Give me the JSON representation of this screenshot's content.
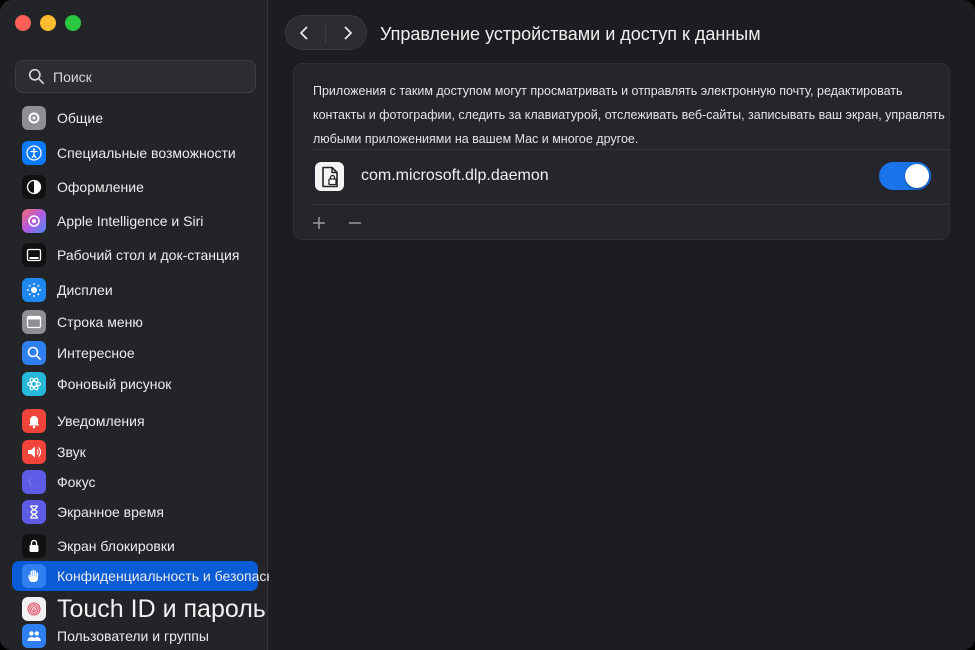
{
  "window": {
    "title": "Управление устройствами и доступ к данным"
  },
  "sidebar": {
    "search": {
      "placeholder": "Поиск",
      "icon": "search-icon"
    },
    "items": [
      {
        "label": "Общие",
        "icon": "gear-icon",
        "color": "#8e8e93"
      },
      {
        "label": "Специальные возможности",
        "icon": "accessibility-icon",
        "color": "#0a7aff"
      },
      {
        "label": "Оформление",
        "icon": "appearance-icon",
        "color": "#111111"
      },
      {
        "label": "Apple Intelligence и Siri",
        "icon": "siri-icon",
        "color": "#c25bd6"
      },
      {
        "label": "Рабочий стол и док-станция",
        "icon": "dock-icon",
        "color": "#111111"
      },
      {
        "label": "Дисплеи",
        "icon": "sun-icon",
        "color": "#1e88f0"
      },
      {
        "label": "Строка меню",
        "icon": "menubar-icon",
        "color": "#8e8e93"
      },
      {
        "label": "Интересное",
        "icon": "spotlight-icon",
        "color": "#2f7ff0"
      },
      {
        "label": "Фоновый рисунок",
        "icon": "wallpaper-icon",
        "color": "#25b8d8"
      },
      {
        "label": "Уведомления",
        "icon": "bell-icon",
        "color": "#f0443a"
      },
      {
        "label": "Звук",
        "icon": "speaker-icon",
        "color": "#f0443a"
      },
      {
        "label": "Фокус",
        "icon": "moon-icon",
        "color": "#5e5ce6"
      },
      {
        "label": "Экранное время",
        "icon": "hourglass-icon",
        "color": "#5e5ce6"
      },
      {
        "label": "Экран блокировки",
        "icon": "lock-icon",
        "color": "#111111"
      },
      {
        "label": "Конфиденциальность и безопасность",
        "icon": "hand-icon",
        "color": "#2f7ff0",
        "active": true
      },
      {
        "label": "Touch ID и пароль",
        "icon": "fingerprint-icon",
        "color": "#f2f2f2"
      },
      {
        "label": "Пользователи и группы",
        "icon": "users-icon",
        "color": "#2f7ff0"
      }
    ]
  },
  "main": {
    "back_icon": "chevron-left-icon",
    "forward_icon": "chevron-right-icon",
    "description": "Приложения с таким доступом могут просматривать и отправлять электронную почту, редактировать контакты и фотографии, следить за клавиатурой, отслеживать веб-сайты, записывать ваш экран, управлять любыми приложениями на вашем Mac и многое другое.",
    "apps": [
      {
        "name": "com.microsoft.dlp.daemon",
        "icon": "document-lock-icon",
        "enabled": true
      }
    ],
    "add_icon": "plus-icon",
    "remove_icon": "minus-icon",
    "accent": "#1a73e8"
  }
}
